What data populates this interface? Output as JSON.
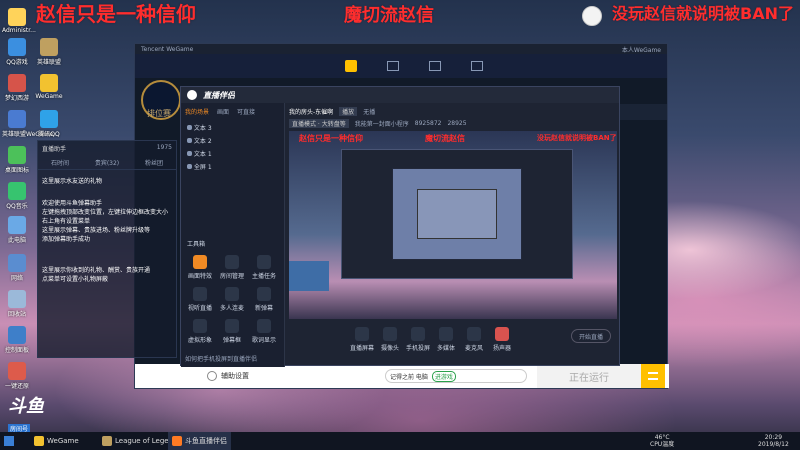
{
  "overlay": {
    "left_red": "赵信只是一种信仰",
    "center_red": "魔切流赵信",
    "right_red": "没玩赵信就说明被BAN了"
  },
  "desktop_icons": [
    {
      "label": "Administr...",
      "icon": "user-folder-icon"
    },
    {
      "label": "QQ游戏",
      "icon": "qq-game-icon"
    },
    {
      "label": "英雄联盟",
      "icon": "lol-icon"
    },
    {
      "label": "梦幻西游",
      "icon": "game-icon"
    },
    {
      "label": "WeGame",
      "icon": "wegame-icon"
    },
    {
      "label": "英雄联盟WeGame...",
      "icon": "lol-icon"
    },
    {
      "label": "腾讯QQ",
      "icon": "qq-icon"
    },
    {
      "label": "桌面图标",
      "icon": "desktop-icon"
    },
    {
      "label": "QQ音乐",
      "icon": "music-icon"
    },
    {
      "label": "此电脑",
      "icon": "computer-icon"
    },
    {
      "label": "网络",
      "icon": "network-icon"
    },
    {
      "label": "回收站",
      "icon": "recycle-bin-icon"
    },
    {
      "label": "控制面板",
      "icon": "control-panel-icon"
    },
    {
      "label": "一键还原",
      "icon": "restore-icon"
    }
  ],
  "wegame": {
    "title": "Tencent WeGame",
    "right_title": "本人WeGame",
    "league_tab": "排位赛",
    "side_label": "文档",
    "running": "正在运行",
    "helper": "辅助设置",
    "bar_text": "记得之前 电脑",
    "bar_badge": "进游戏",
    "footer_settings": "如何把手机投屏到直播伴侣"
  },
  "chat_panel": {
    "title": "直播助手",
    "count": "1975",
    "tabs": [
      "石时间",
      "贵宾(32)",
      "粉丝团"
    ],
    "messages": [
      "这里展示水友送的礼物",
      "欢迎使用斗鱼弹幕助手",
      "左键拖拽顶部改变位置，左键拉伸边框改变大小",
      "右上角有设置菜单",
      "这里展示弹幕、贵族进场、粉丝牌升级等",
      "添加弹幕助手成功",
      "这里展示你收到的礼物、酬赏、贵族开通",
      "点菜单可设置小礼物屏蔽"
    ]
  },
  "obs": {
    "logo": "直播伴侣",
    "tabs": [
      "我的场景",
      "画面",
      "可直接"
    ],
    "layers": [
      "文本 3",
      "文本 2",
      "文本 1",
      "全屏 1"
    ],
    "scene_title": "我的房头-东催啊",
    "scene_tag": "播放",
    "right_tag": "无播",
    "room_tag": "直播模式 · 大转盘等",
    "room_info": "我能第一封面小程序",
    "room_id": "8925872",
    "views": "28925",
    "tools_title": "工具箱",
    "tools": [
      "画面特效",
      "房间管理",
      "主播任务",
      "视听直播",
      "多人连麦",
      "新弹幕",
      "虚拟形象",
      "弹幕框",
      "歌词显示"
    ],
    "bottom_tools": [
      "直播屏幕",
      "摄像头",
      "手机投屏",
      "多媒体",
      "麦克风",
      "扬声器"
    ],
    "start_btn": "开始直播",
    "status": "44"
  },
  "preview": {
    "red_left": "赵信只是一种信仰",
    "red_center": "魔切流赵信",
    "red_right": "没玩赵信就说明被BAN了"
  },
  "brand": {
    "name": "斗鱼",
    "sub": "房间号",
    "room_number": "8925872"
  },
  "taskbar": {
    "items": [
      "WeGame",
      "League of Legends",
      "斗鱼直播伴侣"
    ],
    "temp": "46°C",
    "temp_label": "CPU温度",
    "time": "20:29",
    "date": "2019/8/12"
  },
  "colors": {
    "red_overlay": "#ff2d2d",
    "accent_orange": "#f08a24",
    "wegame_yellow": "#ffc000"
  }
}
